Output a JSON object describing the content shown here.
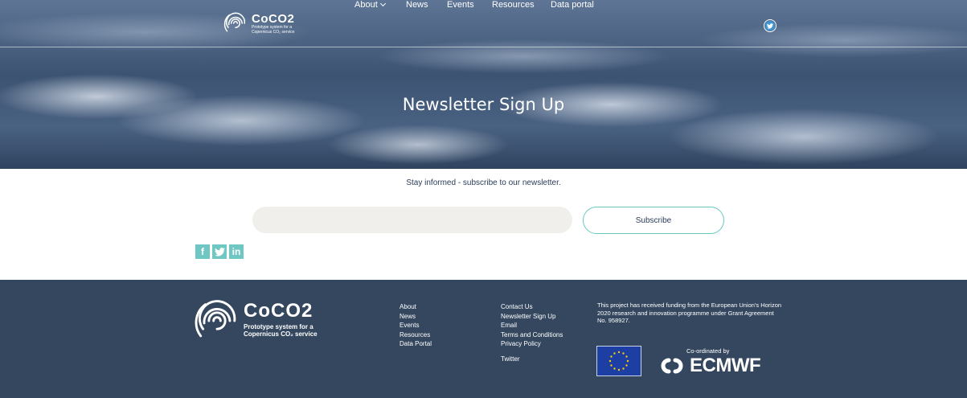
{
  "brand": {
    "name": "CoCO2",
    "tagline_top": "Prototype system for a Copernicus CO₂ service",
    "tagline_footer_line1": "Prototype system for a",
    "tagline_footer_line2": "Copernicus CO₂ service"
  },
  "nav": {
    "items": [
      {
        "label": "About",
        "has_dropdown": true
      },
      {
        "label": "News"
      },
      {
        "label": "Events"
      },
      {
        "label": "Resources"
      },
      {
        "label": "Data portal"
      }
    ],
    "social_icon": "twitter-icon"
  },
  "hero": {
    "title": "Newsletter Sign Up"
  },
  "form": {
    "intro": "Stay informed - subscribe to our newsletter.",
    "email_value": "",
    "email_placeholder": "",
    "subscribe_label": "Subscribe"
  },
  "share": {
    "facebook": "f",
    "twitter_icon": "twitter-icon",
    "linkedin": "in"
  },
  "footer": {
    "col1": [
      "About",
      "News",
      "Events",
      "Resources",
      "Data Portal"
    ],
    "col2": [
      "Contact Us",
      "Newsletter Sign Up",
      "Email",
      "Terms and Conditions",
      "Privacy Policy"
    ],
    "col2_extra": "Twitter",
    "funding_text": "This project has received funding from the European Union's Horizon 2020 research and innovation programme under Grant Agreement No. 958927.",
    "coordinated_by": "Co-ordinated by",
    "ecmwf": "ECMWF"
  },
  "colors": {
    "accent_teal": "#6fc7c4",
    "footer_bg": "#34475f",
    "input_bg": "#f0efeb",
    "eu_blue": "#1d3ea3"
  }
}
